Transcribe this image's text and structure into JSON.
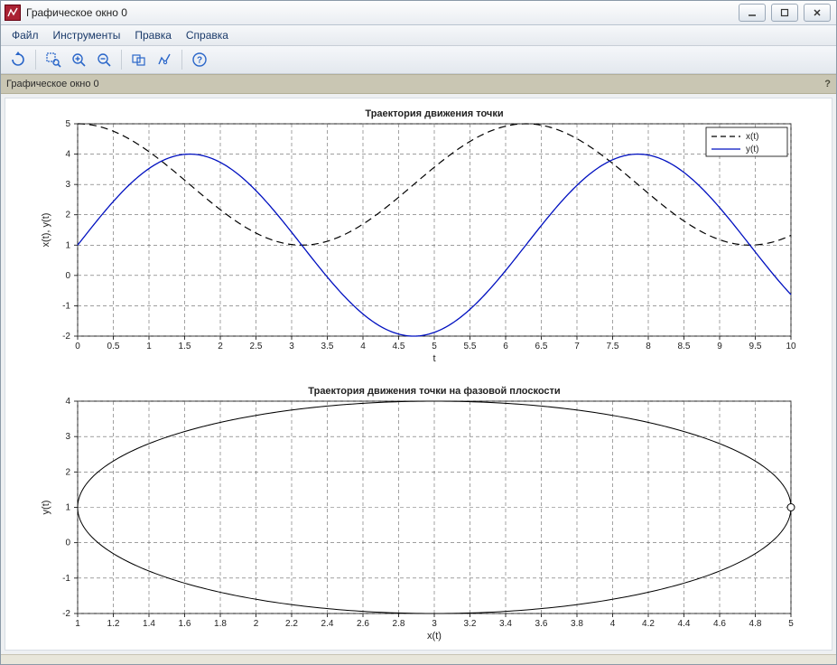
{
  "window": {
    "title": "Графическое окно 0"
  },
  "menu": {
    "file": "Файл",
    "tools": "Инструменты",
    "edit": "Правка",
    "help": "Справка"
  },
  "toolbar": {
    "rotate": "rotate-icon",
    "zoom_area": "zoom-area-icon",
    "zoom_in": "zoom-in-icon",
    "zoom_out": "zoom-out-icon",
    "pan": "pan-icon",
    "datatip": "datatip-icon",
    "help": "help-icon"
  },
  "status": {
    "label": "Графическое окно 0",
    "help_mark": "?"
  },
  "chart_data": [
    {
      "type": "line",
      "title": "Траектория движения точки",
      "xlabel": "t",
      "ylabel": "x(t), y(t)",
      "xlim": [
        0,
        10
      ],
      "ylim": [
        -2,
        5
      ],
      "xticks": [
        0,
        0.5,
        1,
        1.5,
        2,
        2.5,
        3,
        3.5,
        4,
        4.5,
        5,
        5.5,
        6,
        6.5,
        7,
        7.5,
        8,
        8.5,
        9,
        9.5,
        10
      ],
      "yticks": [
        -2,
        -1,
        0,
        1,
        2,
        3,
        4,
        5
      ],
      "legend": {
        "position": "top-right",
        "entries": [
          "x(t)",
          "y(t)"
        ]
      },
      "series": [
        {
          "name": "x(t)",
          "style": "dashed",
          "color": "#000000",
          "formula": "3 + 2*cos(t)",
          "values_at_integer_t": [
            5,
            4.08,
            2.17,
            1.02,
            1.69,
            3.57,
            4.92,
            4.51,
            2.71,
            1.18,
            1.32
          ]
        },
        {
          "name": "y(t)",
          "style": "solid",
          "color": "#0010c0",
          "formula": "1 + 3*sin(t)",
          "values_at_integer_t": [
            1,
            3.52,
            3.73,
            1.42,
            -1.27,
            -1.88,
            0.16,
            2.97,
            3.97,
            2.24,
            -0.63
          ]
        }
      ]
    },
    {
      "type": "line",
      "title": "Траектория движения точки на фазовой плоскости",
      "xlabel": "x(t)",
      "ylabel": "y(t)",
      "xlim": [
        1,
        5
      ],
      "ylim": [
        -2,
        4
      ],
      "xticks": [
        1,
        1.2,
        1.4,
        1.6,
        1.8,
        2,
        2.2,
        2.4,
        2.6,
        2.8,
        3,
        3.2,
        3.4,
        3.6,
        3.8,
        4,
        4.2,
        4.4,
        4.6,
        4.8,
        5
      ],
      "yticks": [
        -2,
        -1,
        0,
        1,
        2,
        3,
        4
      ],
      "parametric": {
        "x": "3 + 2*cos(t)",
        "y": "1 + 3*sin(t)",
        "t_range": [
          0,
          10
        ],
        "style": "solid",
        "color": "#000000"
      },
      "start_point_marker": {
        "x": 5,
        "y": 1,
        "shape": "open-circle"
      }
    }
  ]
}
